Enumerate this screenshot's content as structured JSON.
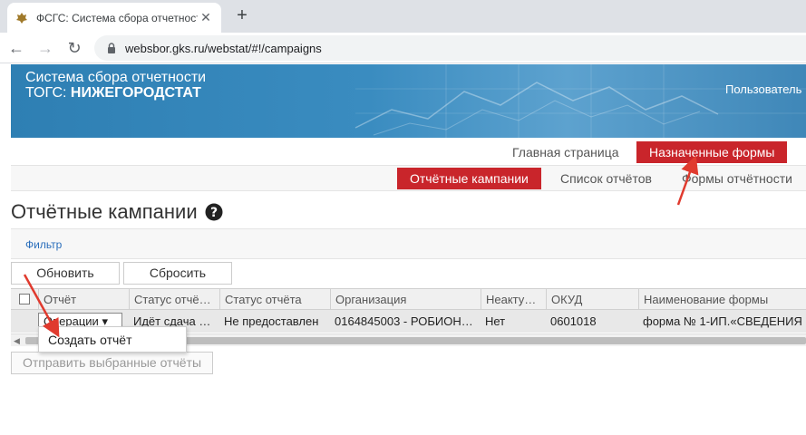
{
  "browser": {
    "tab_title": "ФСГС: Система сбора отчетност",
    "url": "websbor.gks.ru/webstat/#!/campaigns"
  },
  "header": {
    "title_line1": "Система сбора отчетности",
    "title_line2_prefix": "ТОГС:",
    "title_line2_org": "НИЖЕГОРОДСТАТ",
    "user_label": "Пользователь"
  },
  "nav_main": {
    "home": "Главная страница",
    "assigned_forms": "Назначенные формы"
  },
  "nav_sub": {
    "campaigns": "Отчётные кампании",
    "reports_list": "Список отчётов",
    "report_forms": "Формы отчётности"
  },
  "page": {
    "title": "Отчётные кампании",
    "filter_link": "Фильтр",
    "refresh_button": "Обновить",
    "reset_button": "Сбросить",
    "send_selected_button": "Отправить выбранные отчёты"
  },
  "table": {
    "columns": [
      "Отчёт",
      "Статус отчё…",
      "Статус отчёта",
      "Организация",
      "Неакту…",
      "ОКУД",
      "Наименование формы"
    ],
    "row": {
      "operations": "Операции",
      "status_submission": "Идёт сдача …",
      "status_report": "Не предоставлен",
      "organization": "0164845003 - РОБИОН…",
      "inactive": "Нет",
      "okud": "0601018",
      "form_name": "форма № 1-ИП.«СВЕДЕНИЯ …"
    }
  },
  "dropdown": {
    "create_report": "Создать отчёт"
  },
  "colors": {
    "accent_red": "#c9252b",
    "banner_blue": "#3a8cc0",
    "annotation_arrow": "#e03a2e"
  }
}
